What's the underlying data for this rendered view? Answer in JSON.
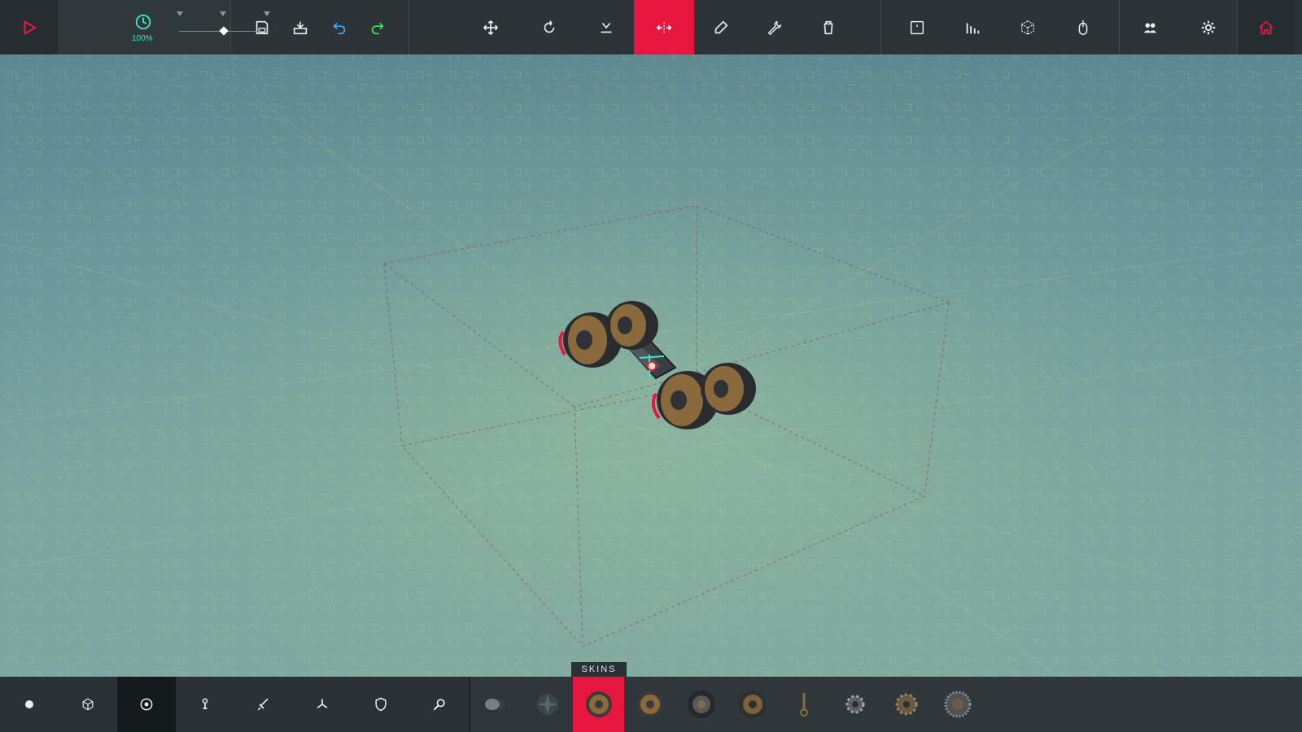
{
  "toolbar": {
    "play_icon": "play-icon",
    "time_scale_label": "100%",
    "file": [
      {
        "name": "save-button",
        "icon": "save-icon"
      },
      {
        "name": "load-button",
        "icon": "load-icon"
      },
      {
        "name": "undo-button",
        "icon": "undo-icon"
      },
      {
        "name": "redo-button",
        "icon": "redo-icon"
      }
    ],
    "tools": [
      {
        "name": "translate-tool-button",
        "icon": "move-arrows-icon"
      },
      {
        "name": "rotate-tool-button",
        "icon": "rotate-icon"
      },
      {
        "name": "snap-down-tool-button",
        "icon": "snap-down-icon"
      },
      {
        "name": "mirror-tool-button",
        "icon": "mirror-icon",
        "active": true
      },
      {
        "name": "pipette-tool-button",
        "icon": "pipette-icon"
      },
      {
        "name": "wrench-tool-button",
        "icon": "wrench-icon"
      },
      {
        "name": "delete-tool-button",
        "icon": "trash-icon"
      }
    ],
    "view": [
      {
        "name": "key-mapper-button",
        "icon": "key-icon"
      },
      {
        "name": "stats-button",
        "icon": "bar-chart-icon"
      },
      {
        "name": "transparency-button",
        "icon": "cube-icon"
      },
      {
        "name": "mouse-orbit-button",
        "icon": "mouse-icon"
      },
      {
        "name": "multiplayer-button",
        "icon": "players-icon"
      },
      {
        "name": "settings-button",
        "icon": "gear-icon"
      },
      {
        "name": "home-button",
        "icon": "home-icon"
      }
    ],
    "accent": "#e8173f",
    "time_color": "#3ee6c8"
  },
  "bottom": {
    "skins_label": "SKINS",
    "categories": [
      {
        "name": "category-basic",
        "icon": "circle-icon"
      },
      {
        "name": "category-blocks",
        "icon": "cube-icon"
      },
      {
        "name": "category-locomotion",
        "icon": "wheel-icon",
        "active": true
      },
      {
        "name": "category-mechanical",
        "icon": "hinge-icon"
      },
      {
        "name": "category-weaponry",
        "icon": "sword-icon"
      },
      {
        "name": "category-flight",
        "icon": "propeller-icon"
      },
      {
        "name": "category-armour",
        "icon": "shield-icon"
      },
      {
        "name": "category-utility",
        "icon": "magnifier-icon"
      }
    ],
    "blocks": [
      {
        "name": "block-small-wheel",
        "icon": "small-wheel-icon"
      },
      {
        "name": "block-unpowered-wheel",
        "icon": "fan-wheel-icon"
      },
      {
        "name": "block-wheel",
        "icon": "wheel-icon",
        "active": true
      },
      {
        "name": "block-large-wheel",
        "icon": "wheel-icon"
      },
      {
        "name": "block-steering-wheel",
        "icon": "dark-wheel-icon"
      },
      {
        "name": "block-suspension-wheel",
        "icon": "wheel-icon"
      },
      {
        "name": "block-piston",
        "icon": "piston-icon"
      },
      {
        "name": "block-small-cog",
        "icon": "cog-icon"
      },
      {
        "name": "block-large-cog",
        "icon": "cog-icon"
      },
      {
        "name": "block-grip-wheel",
        "icon": "gear-wheel-icon"
      }
    ]
  }
}
